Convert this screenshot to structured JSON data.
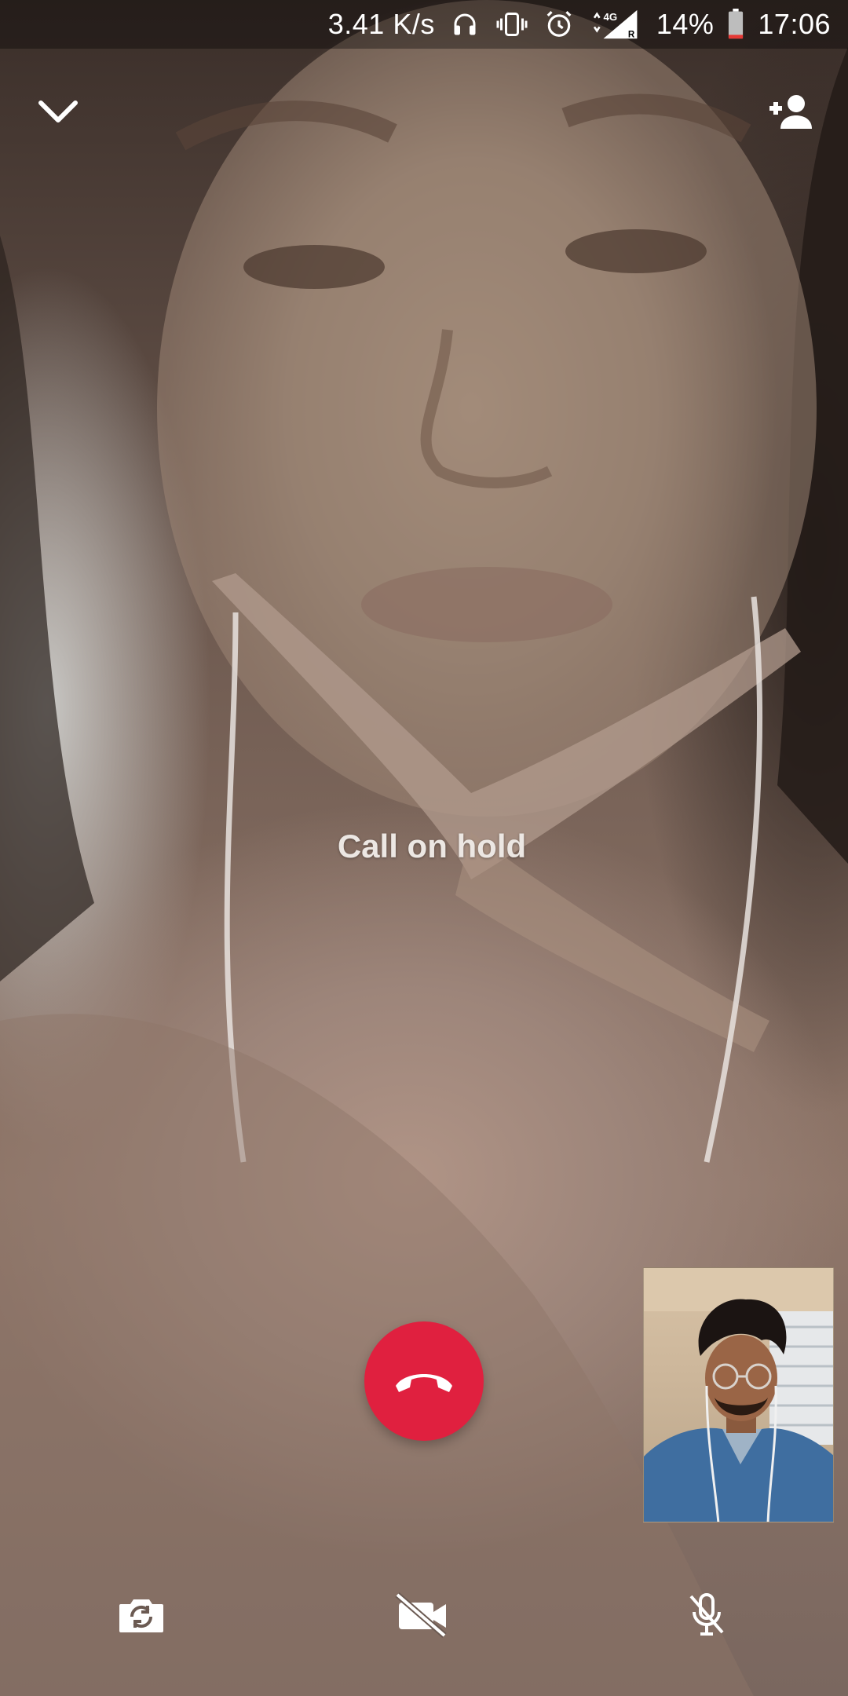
{
  "status_bar": {
    "network_speed": "3.41 K/s",
    "network_type": "4G",
    "roaming_mark": "R",
    "battery_percent": "14%",
    "time": "17:06",
    "icons": [
      "headphones-icon",
      "vibrate-icon",
      "alarm-icon",
      "data-arrows-icon",
      "signal-icon",
      "battery-icon"
    ],
    "battery_level": 0.14,
    "battery_color": "#e53935"
  },
  "call": {
    "status_text": "Call on hold"
  },
  "controls": {
    "top": [
      "chevron-down-icon",
      "add-person-icon"
    ],
    "end_call_color": "#e0203f",
    "bottom": [
      "flip-camera-icon",
      "video-off-icon",
      "mic-off-icon"
    ]
  }
}
